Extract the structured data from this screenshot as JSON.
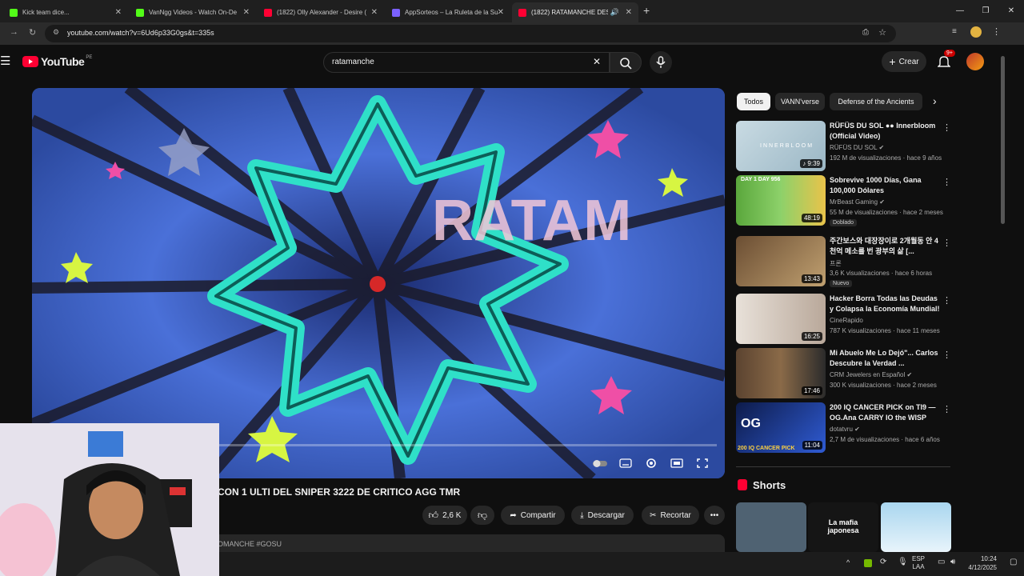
{
  "tabs": [
    {
      "title": "Kick team dice...",
      "favicon_color": "#53fc18"
    },
    {
      "title": "VanNgg Videos - Watch On-De",
      "favicon_color": "#53fc18"
    },
    {
      "title": "(1822) Olly Alexander - Desire (",
      "favicon_color": "#ff0033"
    },
    {
      "title": "AppSorteos – La Ruleta de la Su",
      "favicon_color": "#7b61ff"
    },
    {
      "title": "(1822) RATAMANCHE DESA",
      "favicon_color": "#ff0033"
    }
  ],
  "address": {
    "url": "youtube.com/watch?v=6Ud6p33G0gs&t=335s"
  },
  "youtube": {
    "logo_text": "YouTube",
    "country": "PE",
    "search_value": "ratamanche",
    "create_label": "Crear",
    "notif_count": "9+"
  },
  "video": {
    "title": "CON 1 ULTI DEL SNIPER 3222 DE CRITICO AGG TMR",
    "likes": "2,6 K",
    "share": "Compartir",
    "download": "Descargar",
    "clip": "Recortar",
    "description_snippet": "OMANCHE #GOSU",
    "progress": 0.0,
    "overlay_text": "RATAM"
  },
  "chips": [
    "Todos",
    "VANN'verse",
    "Defense of the Ancients"
  ],
  "recommendations": [
    {
      "title": "RÜFÜS DU SOL ●● Innerbloom (Official Video)",
      "channel": "RÜFÜS DU SOL",
      "meta": "192 M de visualizaciones · hace 9 años",
      "duration": "9:39",
      "thumb_color": "#b9cfd9",
      "thumb_text": "INNERBLOOM",
      "badge": ""
    },
    {
      "title": "Sobrevive 1000 Días, Gana 100,000 Dólares",
      "channel": "MrBeast Gaming",
      "meta": "55 M de visualizaciones · hace 2 meses",
      "duration": "48:19",
      "thumb_color": "#6db34a",
      "thumb_text": "DAY 1   DAY 956",
      "badge": "Doblado"
    },
    {
      "title": "주간보스와 대장장이로 2개월동 안 4천억 메소를 번 광부의 삶 [...",
      "channel": "프론",
      "meta": "3,6 K visualizaciones · hace 6 horas",
      "duration": "13:43",
      "thumb_color": "#8c6a4a",
      "thumb_text": "",
      "badge": "Nuevo"
    },
    {
      "title": "Hacker Borra Todas las Deudas y Colapsa la Economía Mundial!",
      "channel": "CineRapido",
      "meta": "787 K visualizaciones · hace 11 meses",
      "duration": "16:25",
      "thumb_color": "#d8cfc6",
      "thumb_text": "",
      "badge": ""
    },
    {
      "title": "Mi Abuelo Me Lo Dejó\"... Carlos Descubre la Verdad ...",
      "channel": "CRM Jewelers en Español",
      "meta": "300 K visualizaciones · hace 2 meses",
      "duration": "17:46",
      "thumb_color": "#7a5c3e",
      "thumb_text": "",
      "badge": ""
    },
    {
      "title": "200 IQ CANCER PICK on TI9 — OG.Ana CARRY IO the WISP",
      "channel": "dotatvru",
      "meta": "2,7 M de visualizaciones · hace 6 años",
      "duration": "11:04",
      "thumb_color": "#1e3a8a",
      "thumb_text": "200 IQ CANCER PICK",
      "badge": ""
    }
  ],
  "shorts": {
    "label": "Shorts",
    "items": [
      {
        "title": "",
        "color": "#5a6a7a"
      },
      {
        "title": "La mafia japonesa",
        "color": "#151515"
      },
      {
        "title": "",
        "color": "#a9d6ef"
      }
    ]
  },
  "taskbar": {
    "lang": "ESP",
    "layout": "LAA",
    "time": "10:24",
    "date": "4/12/2025"
  }
}
